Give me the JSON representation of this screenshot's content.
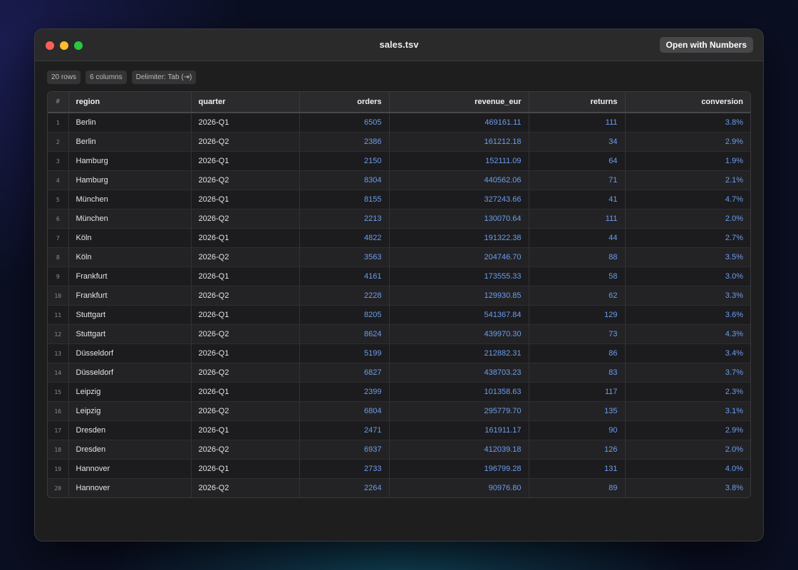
{
  "window": {
    "title": "sales.tsv",
    "open_button": "Open with Numbers"
  },
  "badges": {
    "rows": "20 rows",
    "columns": "6 columns",
    "delimiter": "Delimiter: Tab (⇥)"
  },
  "colors": {
    "numeric_text": "#6c9cf0",
    "traffic_close": "#ff5f57",
    "traffic_minimize": "#febc2e",
    "traffic_zoom": "#28c840"
  },
  "table": {
    "index_header": "#",
    "headers": [
      "region",
      "quarter",
      "orders",
      "revenue_eur",
      "returns",
      "conversion"
    ],
    "rows": [
      [
        "1",
        "Berlin",
        "2026-Q1",
        "6505",
        "469161.11",
        "111",
        "3.8%"
      ],
      [
        "2",
        "Berlin",
        "2026-Q2",
        "2386",
        "161212.18",
        "34",
        "2.9%"
      ],
      [
        "3",
        "Hamburg",
        "2026-Q1",
        "2150",
        "152111.09",
        "64",
        "1.9%"
      ],
      [
        "4",
        "Hamburg",
        "2026-Q2",
        "8304",
        "440562.06",
        "71",
        "2.1%"
      ],
      [
        "5",
        "München",
        "2026-Q1",
        "8155",
        "327243.66",
        "41",
        "4.7%"
      ],
      [
        "6",
        "München",
        "2026-Q2",
        "2213",
        "130070.64",
        "111",
        "2.0%"
      ],
      [
        "7",
        "Köln",
        "2026-Q1",
        "4822",
        "191322.38",
        "44",
        "2.7%"
      ],
      [
        "8",
        "Köln",
        "2026-Q2",
        "3563",
        "204746.70",
        "88",
        "3.5%"
      ],
      [
        "9",
        "Frankfurt",
        "2026-Q1",
        "4161",
        "173555.33",
        "58",
        "3.0%"
      ],
      [
        "10",
        "Frankfurt",
        "2026-Q2",
        "2228",
        "129930.85",
        "62",
        "3.3%"
      ],
      [
        "11",
        "Stuttgart",
        "2026-Q1",
        "8205",
        "541367.84",
        "129",
        "3.6%"
      ],
      [
        "12",
        "Stuttgart",
        "2026-Q2",
        "8624",
        "439970.30",
        "73",
        "4.3%"
      ],
      [
        "13",
        "Düsseldorf",
        "2026-Q1",
        "5199",
        "212882.31",
        "86",
        "3.4%"
      ],
      [
        "14",
        "Düsseldorf",
        "2026-Q2",
        "6827",
        "438703.23",
        "83",
        "3.7%"
      ],
      [
        "15",
        "Leipzig",
        "2026-Q1",
        "2399",
        "101358.63",
        "117",
        "2.3%"
      ],
      [
        "16",
        "Leipzig",
        "2026-Q2",
        "6804",
        "295779.70",
        "135",
        "3.1%"
      ],
      [
        "17",
        "Dresden",
        "2026-Q1",
        "2471",
        "161911.17",
        "90",
        "2.9%"
      ],
      [
        "18",
        "Dresden",
        "2026-Q2",
        "6937",
        "412039.18",
        "126",
        "2.0%"
      ],
      [
        "19",
        "Hannover",
        "2026-Q1",
        "2733",
        "196799.28",
        "131",
        "4.0%"
      ],
      [
        "20",
        "Hannover",
        "2026-Q2",
        "2264",
        "90976.80",
        "89",
        "3.8%"
      ]
    ]
  }
}
